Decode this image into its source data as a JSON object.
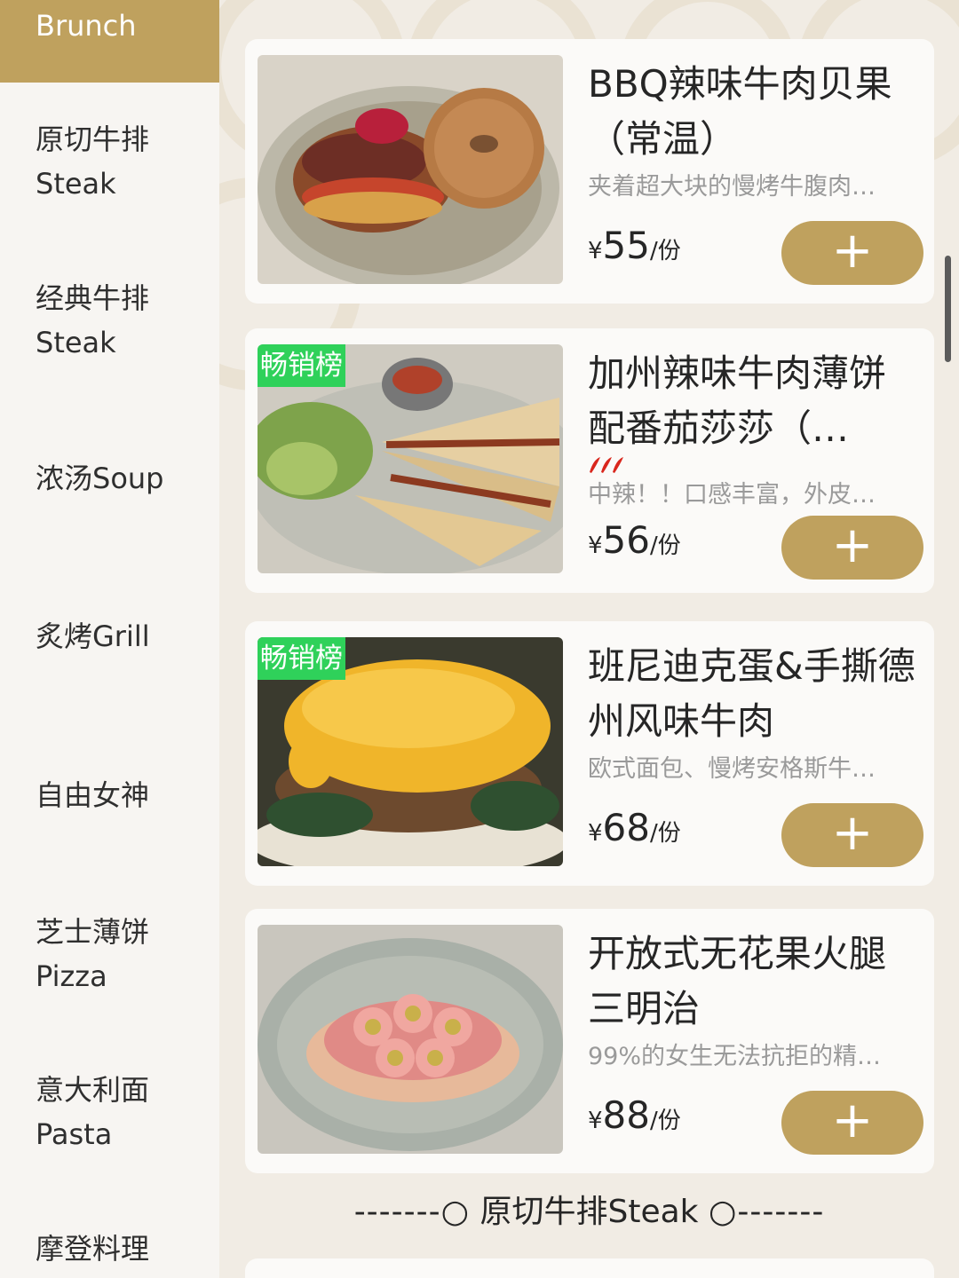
{
  "sidebar": {
    "items": [
      {
        "line1": "Brunch",
        "line2": ""
      },
      {
        "line1": "原切牛排",
        "line2": "Steak"
      },
      {
        "line1": "经典牛排",
        "line2": "Steak"
      },
      {
        "line1": "浓汤Soup",
        "line2": ""
      },
      {
        "line1": "炙烤Grill",
        "line2": ""
      },
      {
        "line1": "自由女神",
        "line2": ""
      },
      {
        "line1": "芝士薄饼",
        "line2": "Pizza"
      },
      {
        "line1": "意大利面",
        "line2": "Pasta"
      },
      {
        "line1": "摩登料理",
        "line2": ""
      }
    ],
    "active_index": 0
  },
  "products": [
    {
      "title": "BBQ辣味牛肉贝果（常温）",
      "badge": "",
      "desc": "夹着超大块的慢烤牛腹肉…",
      "currency": "¥",
      "price": "55",
      "unit": "/份",
      "add_label": "+"
    },
    {
      "title": "加州辣味牛肉薄饼配番茄莎莎（…",
      "badge": "畅销榜",
      "spicy_level": 3,
      "desc": "中辣！！口感丰富，外皮…",
      "currency": "¥",
      "price": "56",
      "unit": "/份",
      "add_label": "+"
    },
    {
      "title": "班尼迪克蛋&手撕德州风味牛肉",
      "badge": "畅销榜",
      "desc": "欧式面包、慢烤安格斯牛…",
      "currency": "¥",
      "price": "68",
      "unit": "/份",
      "add_label": "+"
    },
    {
      "title": "开放式无花果火腿三明治",
      "badge": "",
      "desc": "99%的女生无法抗拒的精…",
      "currency": "¥",
      "price": "88",
      "unit": "/份",
      "add_label": "+"
    }
  ],
  "section": {
    "left_dashes": "-------○",
    "title": "原切牛排Steak",
    "right_dashes": "○-------"
  },
  "colors": {
    "accent": "#bfa15e",
    "badge": "#2fd15a",
    "background": "#f1ece4",
    "sidebar": "#f7f5f2"
  }
}
